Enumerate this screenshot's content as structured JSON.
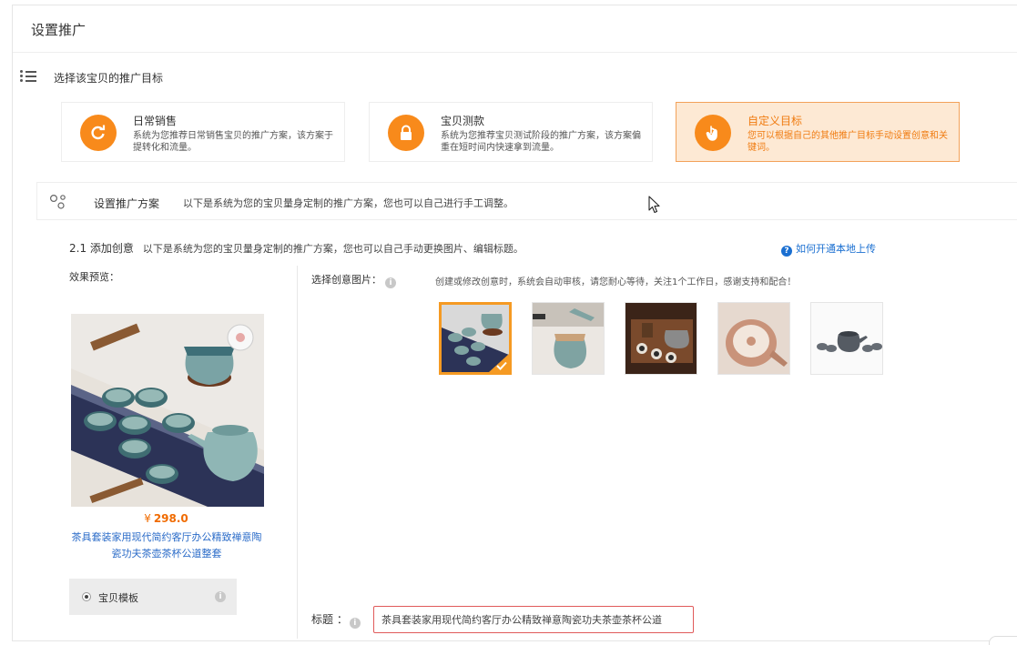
{
  "page": {
    "title": "设置推广"
  },
  "goal_section": {
    "label": "选择该宝贝的推广目标"
  },
  "goals": [
    {
      "title": "日常销售",
      "desc": "系统为您推荐日常销售宝贝的推广方案，该方案于提转化和流量。"
    },
    {
      "title": "宝贝测款",
      "desc": "系统为您推荐宝贝测试阶段的推广方案，该方案偏重在短时间内快速拿到流量。"
    },
    {
      "title": "自定义目标",
      "desc": "您可以根据自己的其他推广目标手动设置创意和关键词。"
    }
  ],
  "plan_section": {
    "title": "设置推广方案",
    "desc": "以下是系统为您的宝贝量身定制的推广方案，您也可以自己进行手工调整。"
  },
  "creative": {
    "heading": "2.1 添加创意",
    "heading_desc": "以下是系统为您的宝贝量身定制的推广方案，您也可以自己手动更换图片、编辑标题。",
    "upload_help": "如何开通本地上传",
    "preview_label": "效果预览：",
    "price_symbol": "¥",
    "price": "298.0",
    "product_title": "茶具套装家用现代简约客厅办公精致禅意陶瓷功夫茶壶茶杯公道整套",
    "template_label": "宝贝模板",
    "select_label": "选择创意图片：",
    "select_note": "创建或修改创意时，系统会自动审核，请您耐心等待，关注1个工作日，感谢支持和配合！",
    "title_label": "标题 ：",
    "title_value": "茶具套装家用现代简约客厅办公精致禅意陶瓷功夫茶壶茶杯公道"
  },
  "colors": {
    "accent": "#f88a1b",
    "link": "#2a6bc8",
    "price": "#f06b00",
    "selected_border": "#f59a23"
  }
}
